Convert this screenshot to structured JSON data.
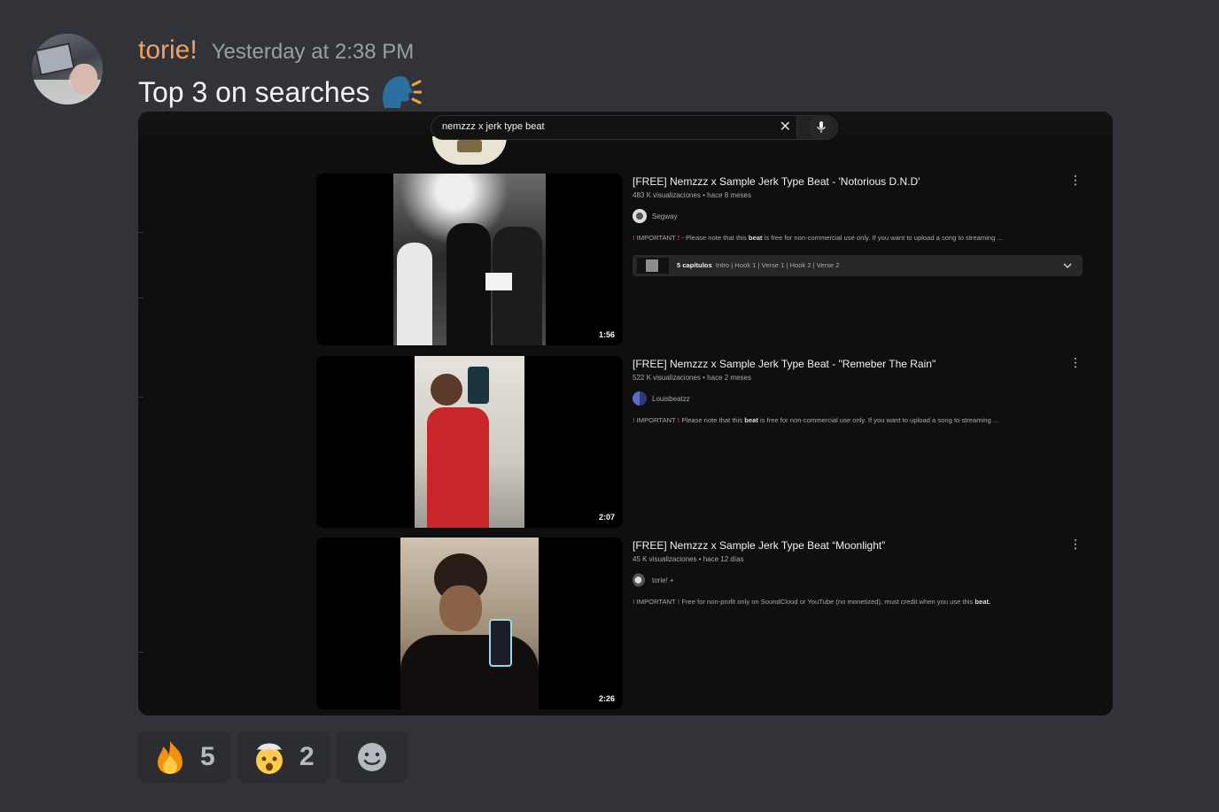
{
  "message": {
    "username": "torie!",
    "timestamp": "Yesterday at 2:38 PM",
    "text": "Top 3 on searches",
    "text_emoji": "speaking-head-emoji",
    "username_color": "#f0a063"
  },
  "embed": {
    "search_query": "nemzzz x jerk type beat",
    "videos": [
      {
        "title": "[FREE] Nemzzz x Sample Jerk Type Beat - 'Notorious D.N.D'",
        "meta": "483 K visualizaciones • hace 8 meses",
        "channel": "Segway",
        "desc_prefix": "IMPORTANT",
        "desc_pre": "- Please note that this",
        "desc_bold": "beat",
        "desc_post": "is free for non-commercial use only. If you want to upload a song to streaming ...",
        "duration": "1:56",
        "chapters_count": "5 capítulos",
        "chapters_list": "Intro | Hook 1 | Verse 1 | Hook 2 | Verse 2"
      },
      {
        "title": "[FREE] Nemzzz x Sample Jerk Type Beat - \"Remeber The Rain\"",
        "meta": "522 K visualizaciones • hace 2 meses",
        "channel": "Louisbeatzz",
        "desc_prefix": "IMPORTANT",
        "desc_pre": "Please note that this",
        "desc_bold": "beat",
        "desc_post": "is free for non-commercial use only. If you want to upload a song to streaming ...",
        "duration": "2:07"
      },
      {
        "title": "[FREE] Nemzzz x Sample Jerk Type Beat “Moonlight”",
        "meta": "45 K visualizaciones • hace 12 días",
        "channel": "torie! +",
        "desc_prefix": "IMPORTANT",
        "desc_pre": "Free for non-profit only on SoundCloud or YouTube (no monetized), must credit when you use this",
        "desc_bold": "beat.",
        "desc_post": "",
        "duration": "2:26"
      }
    ]
  },
  "reactions": [
    {
      "emoji": "fire-emoji",
      "count": "5"
    },
    {
      "emoji": "exploding-head-emoji",
      "count": "2"
    }
  ],
  "add_reaction": "add-reaction-icon"
}
